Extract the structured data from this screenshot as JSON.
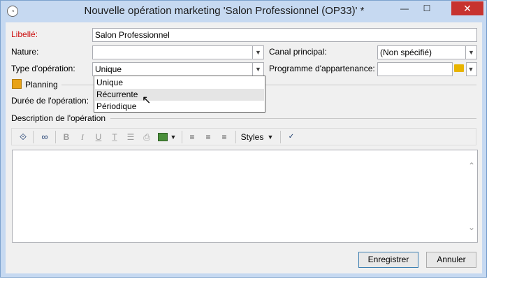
{
  "window": {
    "title": "Nouvelle opération marketing 'Salon Professionnel (OP33)' *",
    "minimize_glyph": "—",
    "maximize_glyph": "☐",
    "close_glyph": "✕"
  },
  "form": {
    "libelle_label": "Libellé:",
    "libelle_value": "Salon Professionnel",
    "nature_label": "Nature:",
    "nature_value": "",
    "canal_label": "Canal principal:",
    "canal_value": "(Non spécifié)",
    "type_label": "Type d'opération:",
    "type_value": "Unique",
    "programme_label": "Programme d'appartenance:",
    "programme_value": "",
    "planning_label": "Planning",
    "duree_label": "Durée de l'opération:",
    "description_label": "Description de l'opération"
  },
  "dropdown": {
    "options": [
      "Unique",
      "Récurrente",
      "Périodique"
    ],
    "hovered": "Récurrente"
  },
  "toolbar": {
    "styles_label": "Styles",
    "bold": "B",
    "italic": "I",
    "underline": "U"
  },
  "buttons": {
    "save_label": "Enregistrer",
    "cancel_label": "Annuler"
  },
  "colors": {
    "required_label": "#cc1111",
    "close_button": "#c7332f",
    "window_frame": "#c6d9f1",
    "folder_icon": "#e8b400",
    "calendar_icon": "#e8a317"
  }
}
